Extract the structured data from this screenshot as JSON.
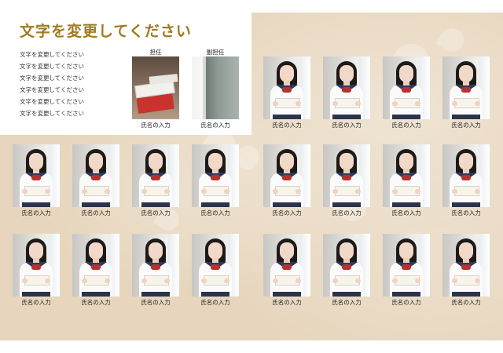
{
  "header": {
    "title": "文字を変更してください",
    "lines": [
      "文字を変更してください",
      "文字を変更してください",
      "文字を変更してください",
      "文字を変更してください",
      "文字を変更してください",
      "文字を変更してください"
    ]
  },
  "staff": [
    {
      "role": "担任",
      "name": "氏名の入力",
      "photo": "books-photo"
    },
    {
      "role": "副担任",
      "name": "氏名の入力",
      "photo": "door-photo"
    }
  ],
  "students": [
    {
      "name": "氏名の入力"
    },
    {
      "name": "氏名の入力"
    },
    {
      "name": "氏名の入力"
    },
    {
      "name": "氏名の入力"
    },
    {
      "name": "氏名の入力"
    },
    {
      "name": "氏名の入力"
    },
    {
      "name": "氏名の入力"
    },
    {
      "name": "氏名の入力"
    },
    {
      "name": "氏名の入力"
    },
    {
      "name": "氏名の入力"
    },
    {
      "name": "氏名の入力"
    },
    {
      "name": "氏名の入力"
    },
    {
      "name": "氏名の入力"
    },
    {
      "name": "氏名の入力"
    },
    {
      "name": "氏名の入力"
    },
    {
      "name": "氏名の入力"
    },
    {
      "name": "氏名の入力"
    },
    {
      "name": "氏名の入力"
    },
    {
      "name": "氏名の入力"
    },
    {
      "name": "氏名の入力"
    }
  ],
  "colors": {
    "title": "#a07a1e",
    "background": "#e7d6bd"
  }
}
